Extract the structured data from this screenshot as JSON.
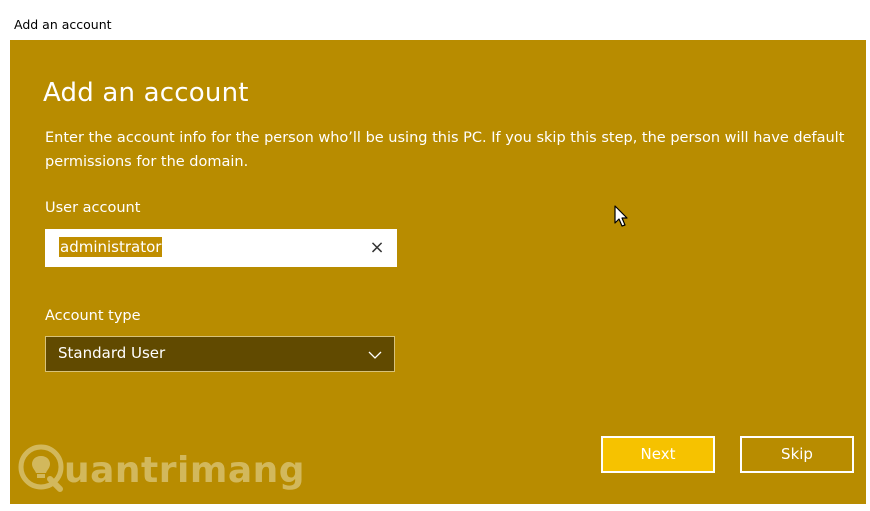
{
  "window": {
    "title": "Add an account"
  },
  "dialog": {
    "heading": "Add an account",
    "description": "Enter the account info for the person who’ll be using this PC. If you skip this step, the person will have default permissions for the domain.",
    "user_account": {
      "label": "User account",
      "value": "administrator",
      "clear_glyph": "×"
    },
    "account_type": {
      "label": "Account type",
      "selected": "Standard User"
    },
    "buttons": {
      "next": "Next",
      "skip": "Skip"
    }
  },
  "watermark": {
    "text": "uantrimang",
    "logo_icon": "lightbulb-q-logo"
  },
  "colors": {
    "background": "#b88c00",
    "select_bg": "#614a00",
    "next_button": "#f6c200"
  }
}
